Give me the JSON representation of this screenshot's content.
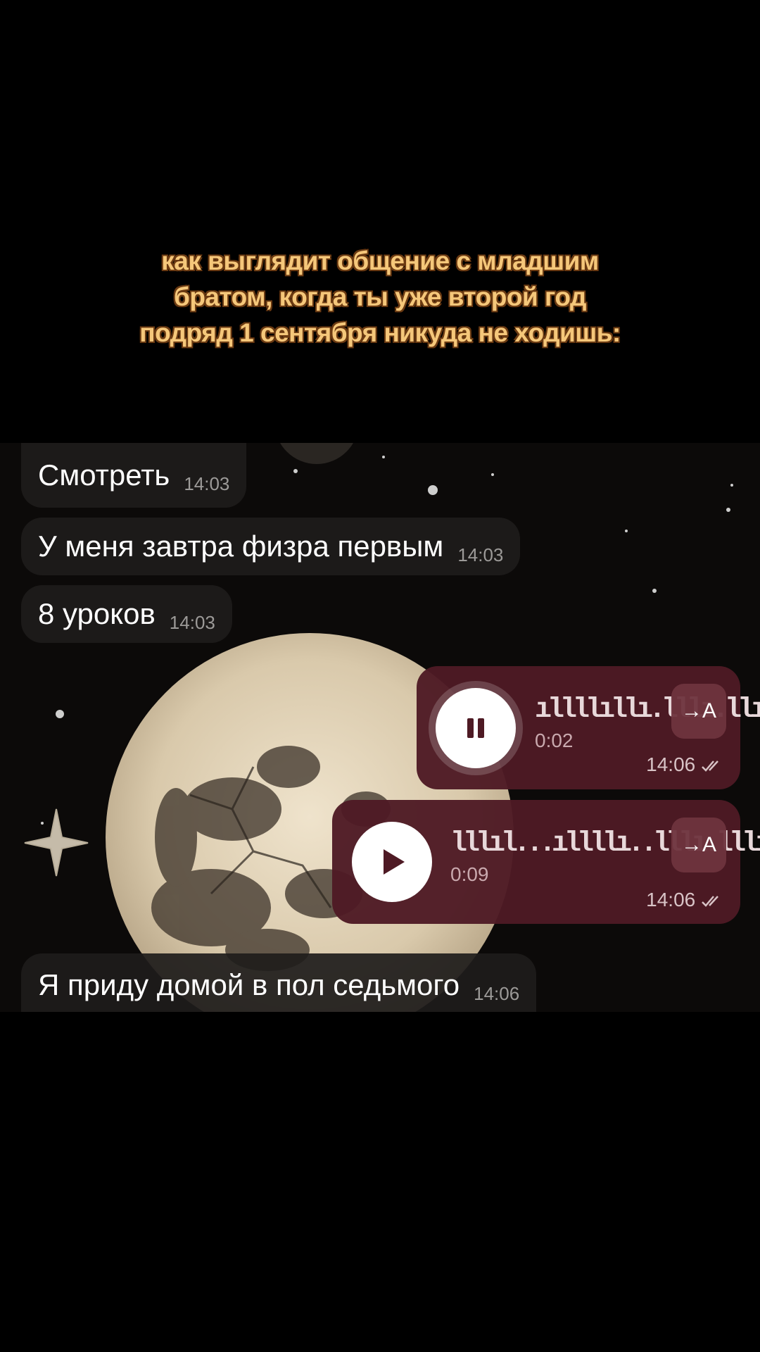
{
  "caption": {
    "lines": [
      "как выглядит общение с младшим",
      "братом, когда ты уже второй год",
      "подряд 1 сентября никуда не ходишь:"
    ]
  },
  "messages": [
    {
      "text": "Смотреть",
      "time": "14:03"
    },
    {
      "text": "У меня завтра физра первым",
      "time": "14:03"
    },
    {
      "text": "8 уроков",
      "time": "14:03"
    }
  ],
  "voice_messages": [
    {
      "state": "playing",
      "waveform": "ıllllıllı.lllı.llıı.l",
      "duration": "0:02",
      "time": "14:06",
      "transcribe_label": "→A",
      "status_icon": "double-check-icon"
    },
    {
      "state": "paused",
      "waveform": "lllıl...ıllllı..lllı.lllı.",
      "duration": "0:09",
      "time": "14:06",
      "transcribe_label": "→A",
      "status_icon": "double-check-icon"
    }
  ],
  "last_message": {
    "text": "Я приду домой в пол седьмого",
    "time": "14:06"
  },
  "colors": {
    "caption": "#f5c77a",
    "incoming_bubble": "#1e1c1b",
    "outgoing_bubble": "#4e1a24",
    "moon": "#e9dcc4"
  }
}
